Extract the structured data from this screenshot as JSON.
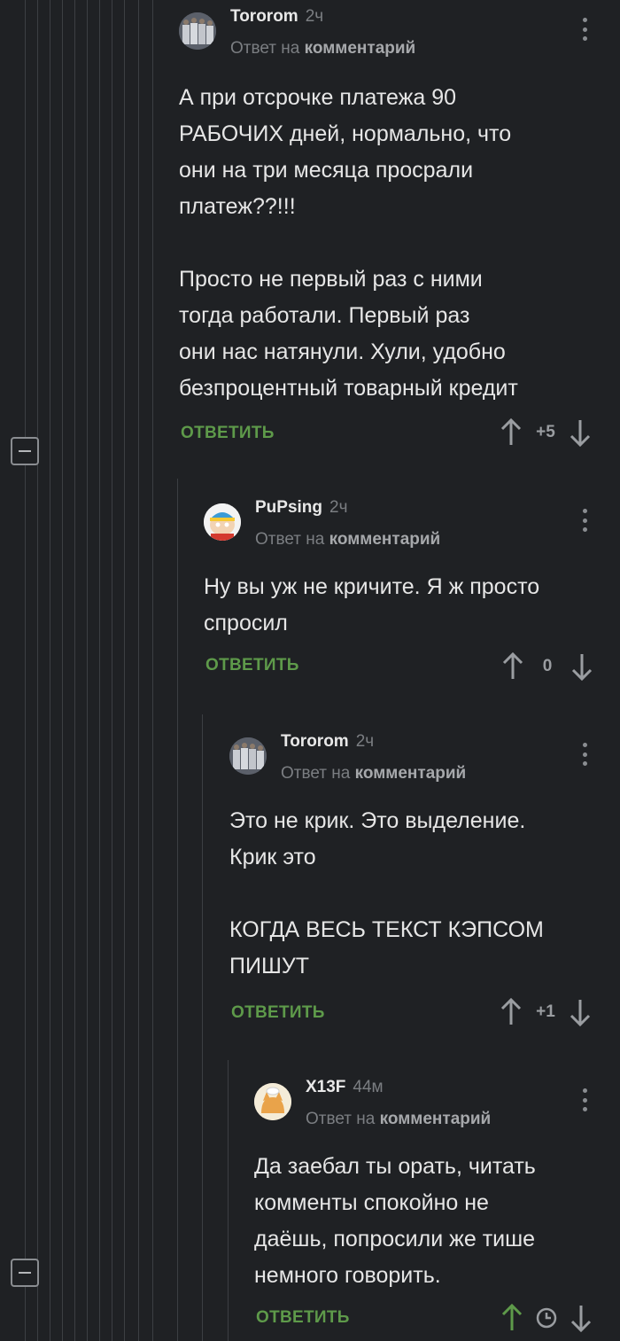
{
  "ui": {
    "reply_label": "ОТВЕТИТЬ",
    "reply_to_prefix": "Ответ на",
    "reply_to_target": "комментарий"
  },
  "colors": {
    "background": "#1f2124",
    "accent_green": "#5e9a4a",
    "muted": "#7b7e82"
  },
  "comments": [
    {
      "username": "Tororom",
      "time": "2ч",
      "avatar": "group-photo-avatar",
      "text": "А при отсрочке платежа 90\nРАБОЧИХ дней, нормально, что\nони на три месяца просрали\nплатеж??!!!\n\nПросто не первый раз с ними\nтогда работали. Первый раз\nони нас натянули. Хули, удобно\nбезпроцентный товарный кредит",
      "score": "+5"
    },
    {
      "username": "PuPsing",
      "time": "2ч",
      "avatar": "cartoon-character-avatar",
      "text": "Ну вы уж не кричите. Я ж просто\nспросил",
      "score": "0"
    },
    {
      "username": "Tororom",
      "time": "2ч",
      "avatar": "group-photo-avatar",
      "text": "Это не крик. Это выделение.\nКрик это\n\nКОГДА ВЕСЬ ТЕКСТ КЭПСОМ\nПИШУТ",
      "score": "+1"
    },
    {
      "username": "X13F",
      "time": "44м",
      "avatar": "cat-avatar",
      "text": "Да заебал ты орать, читать\nкомменты спокойно не\nдаёшь, попросили же тише\nнемного говорить.",
      "score": "clock-icon"
    }
  ]
}
